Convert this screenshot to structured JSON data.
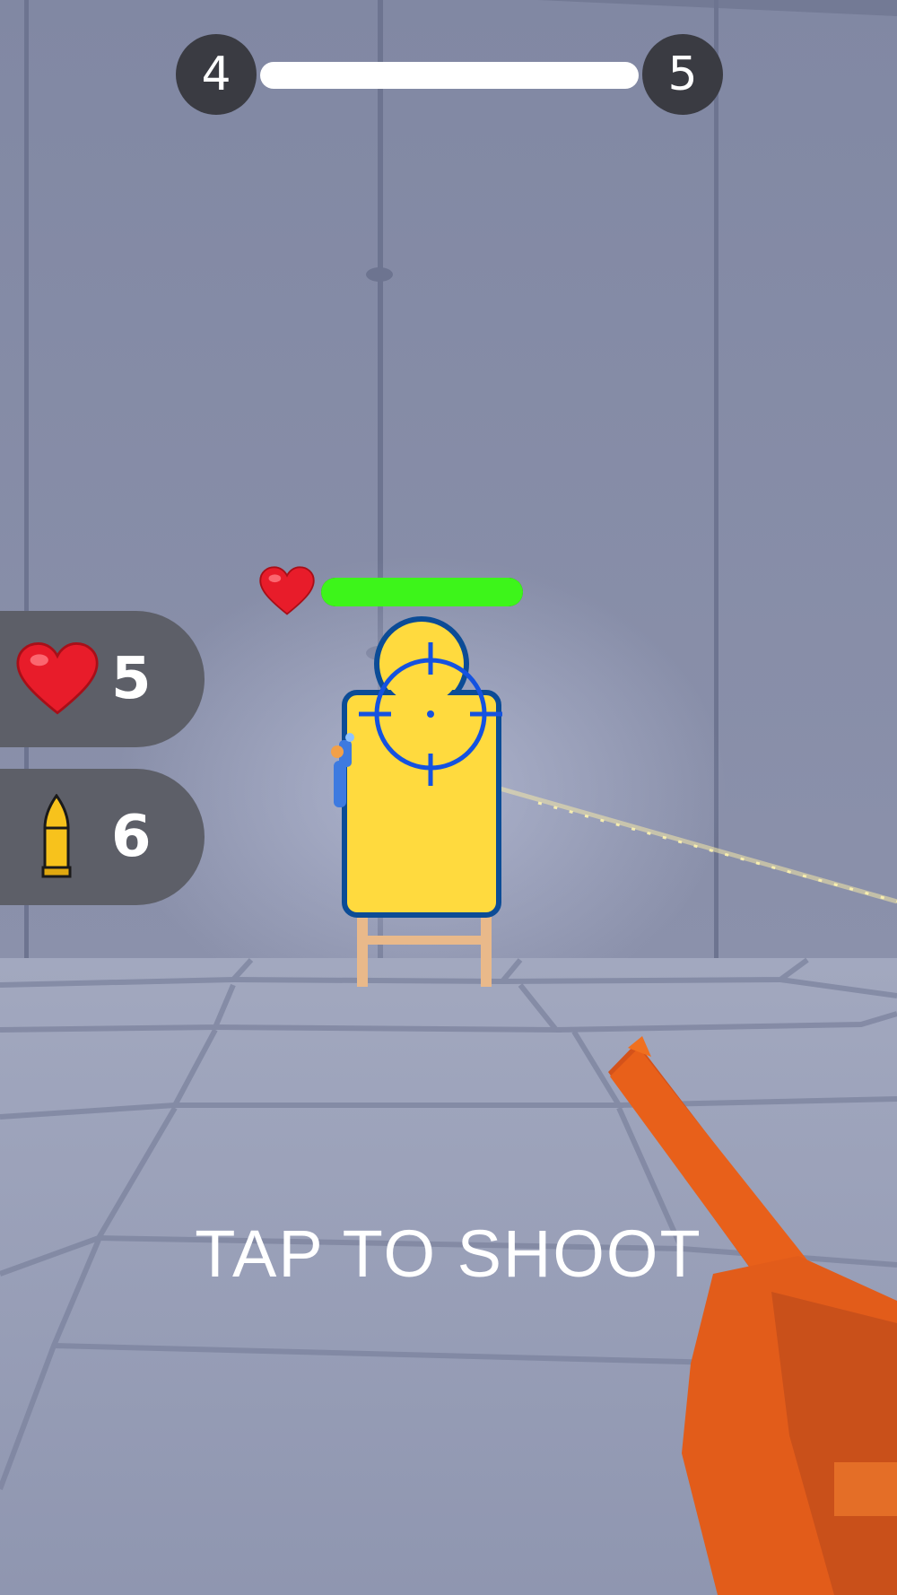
{
  "level": {
    "current": "4",
    "next": "5",
    "progress": 1.0
  },
  "stats": {
    "lives": "5",
    "ammo": "6"
  },
  "enemy": {
    "health": 1.0
  },
  "hint": "TAP TO SHOOT",
  "colors": {
    "target_fill": "#ffda3e",
    "target_outline": "#0c4c96",
    "crosshair": "#1452e0",
    "enemy_health": "#3df51a",
    "gun": "#e8601a",
    "badge_bg": "#3a3b42",
    "pill_bg": "#5d5f68"
  },
  "icons": {
    "lives": "heart-icon",
    "ammo": "bullet-icon",
    "enemy": "heart-icon",
    "aim": "crosshair-icon"
  }
}
